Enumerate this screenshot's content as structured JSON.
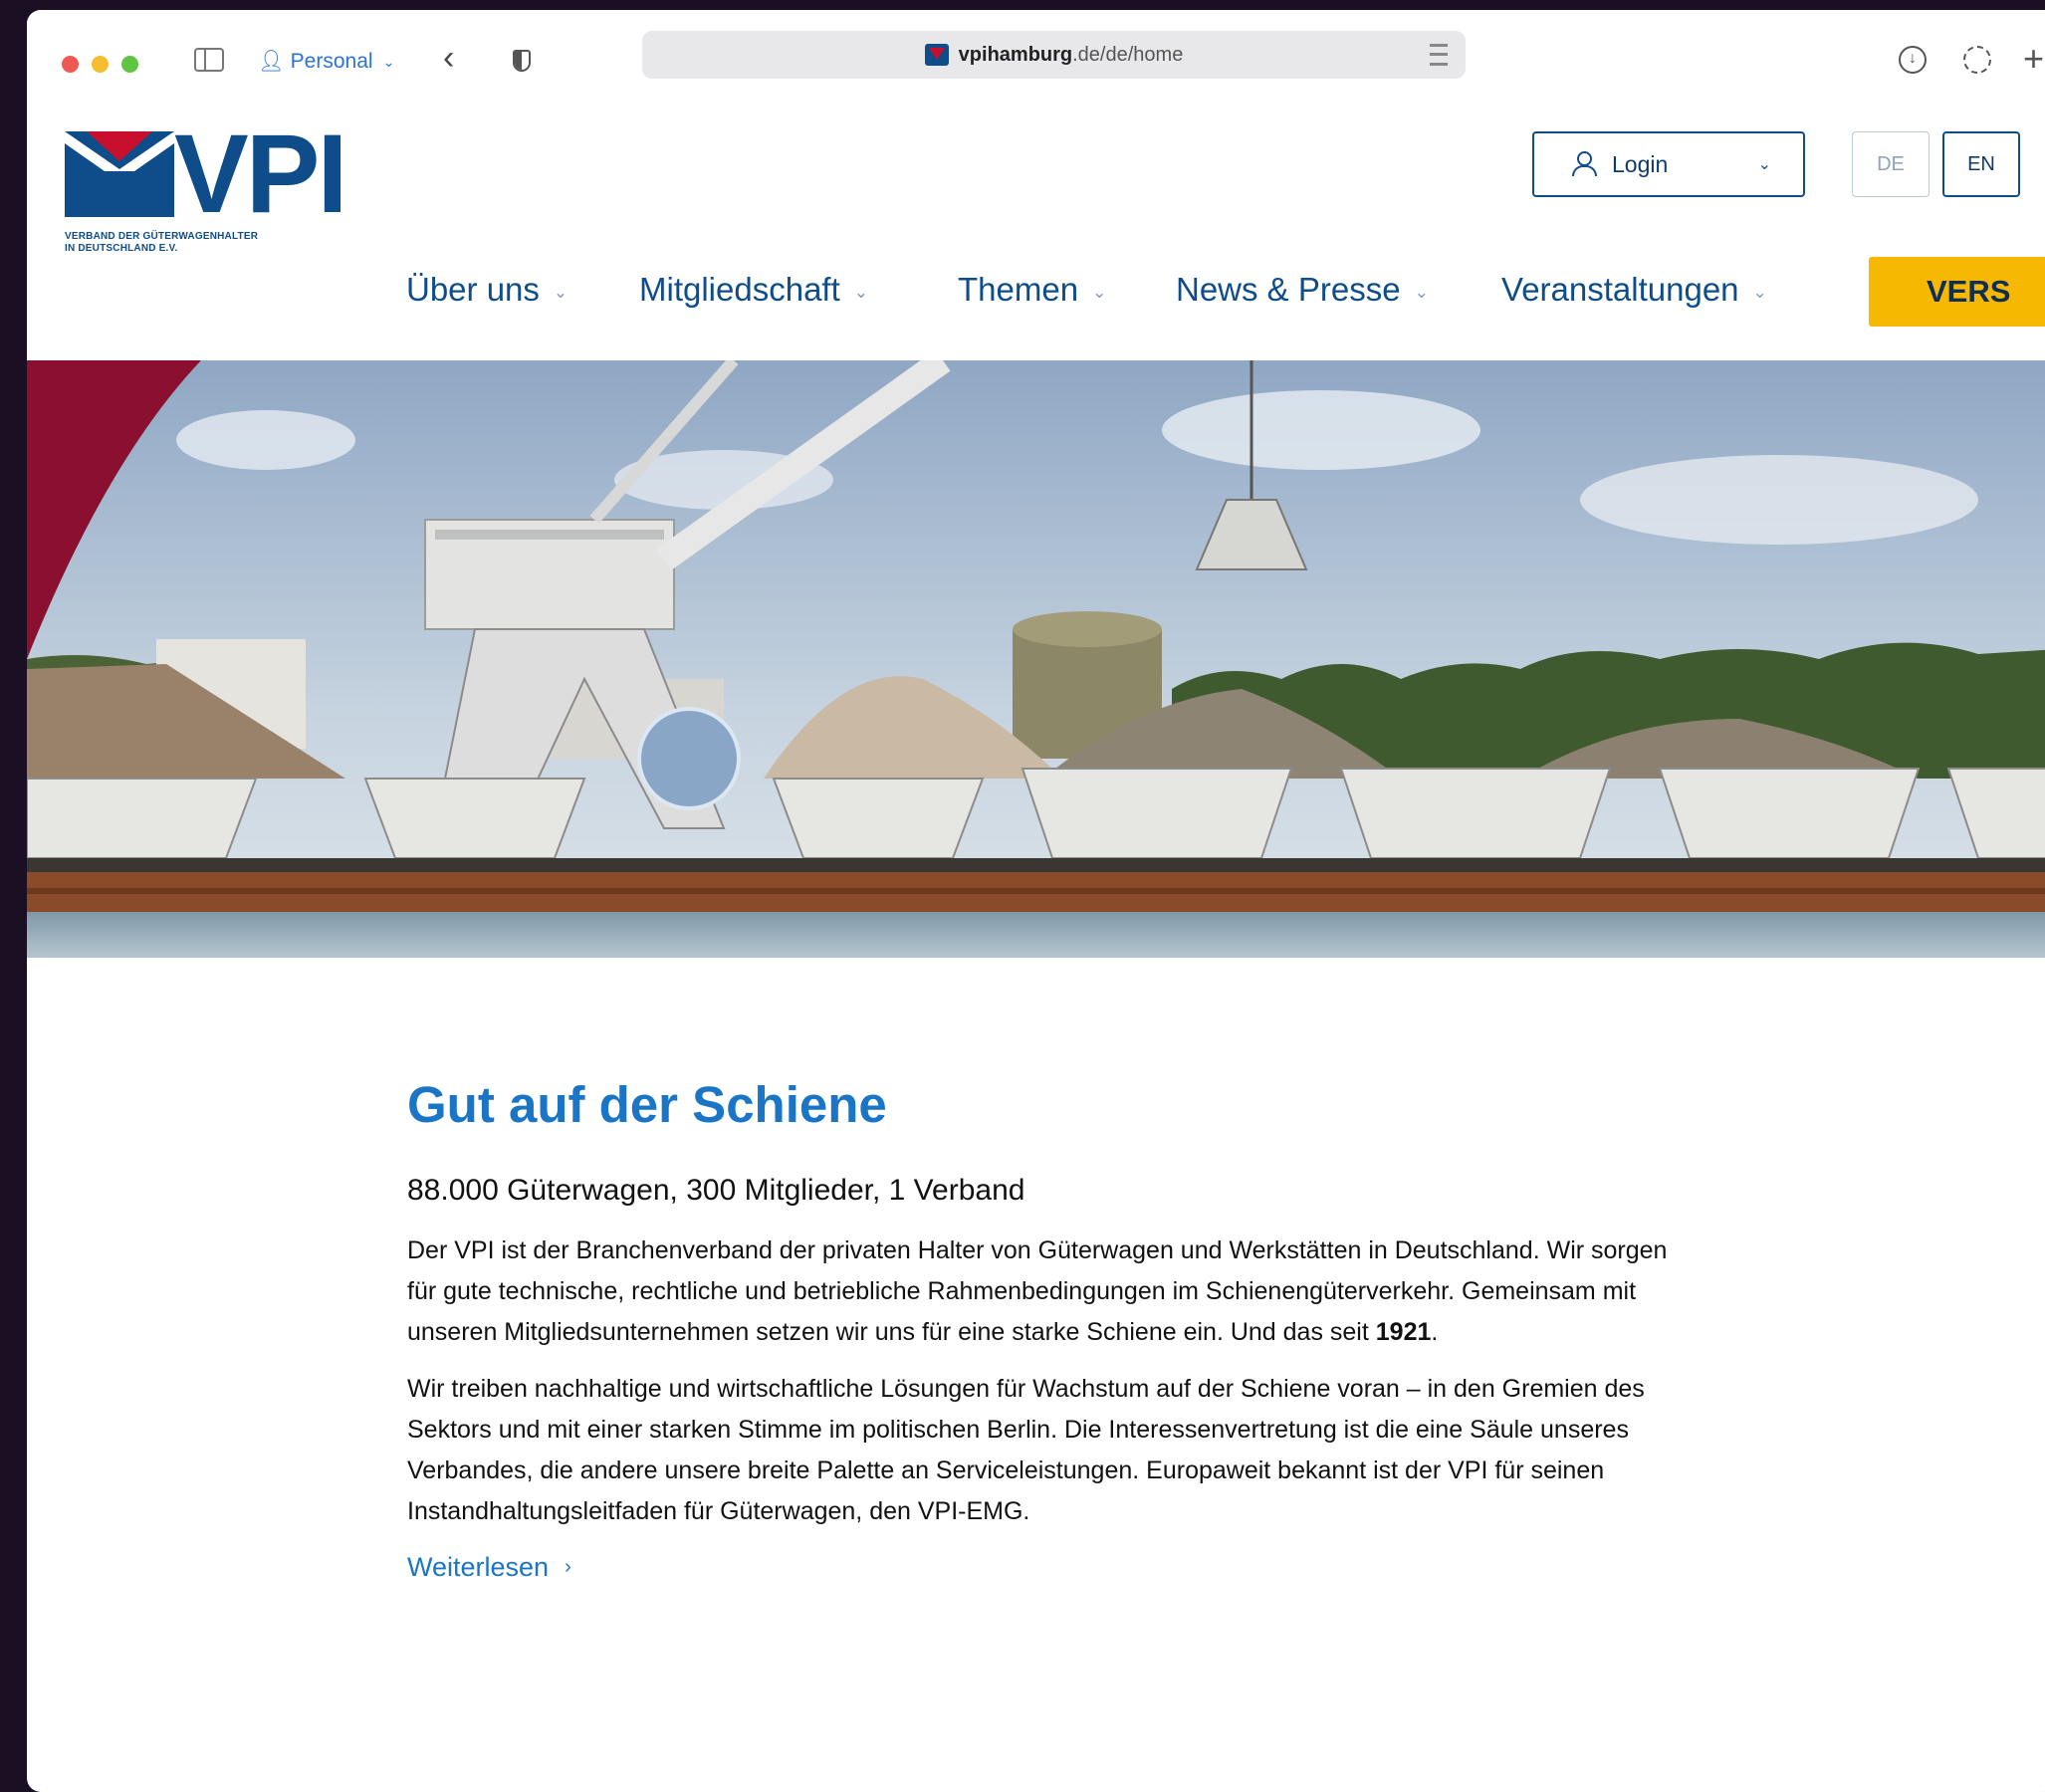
{
  "browser": {
    "profile": "Personal",
    "url_domain": "vpihamburg",
    "url_rest": ".de/de/home"
  },
  "header": {
    "logo_text": "VPI",
    "logo_subtitle_line1": "VERBAND DER GÜTERWAGENHALTER",
    "logo_subtitle_line2": "IN DEUTSCHLAND E.V.",
    "login_label": "Login",
    "lang_de": "DE",
    "lang_en": "EN",
    "nav": [
      {
        "label": "Über uns"
      },
      {
        "label": "Mitgliedschaft"
      },
      {
        "label": "Themen"
      },
      {
        "label": "News & Presse"
      },
      {
        "label": "Veranstaltungen"
      }
    ],
    "cta_label": "VERS"
  },
  "content": {
    "title": "Gut auf der Schiene",
    "subtitle": "88.000 Güterwagen, 300 Mitglieder, 1 Verband",
    "para1": "Der VPI ist der Branchenverband der privaten Halter von Güterwagen und Werkstätten in Deutschland. Wir sorgen für gute technische, rechtliche und betriebliche Rahmenbedingungen im Schienengüterverkehr. Gemeinsam mit unseren Mitgliedsunternehmen setzen wir uns für eine starke Schiene ein. Und das seit ",
    "para1_year": "1921",
    "para1_end": ".",
    "para2": "Wir treiben nachhaltige und wirtschaftliche Lösungen für Wachstum auf der Schiene voran – in den Gremien des Sektors und mit einer starken Stimme im politischen Berlin. Die Interessenvertretung ist die eine Säule unseres Verbandes, die andere unsere breite Palette an Serviceleistungen. Europaweit bekannt ist der VPI für seinen Instandhaltungsleitfaden für Güterwagen, den VPI-EMG.",
    "read_more": "Weiterlesen"
  },
  "colors": {
    "brand_blue": "#0f4d8a",
    "link_blue": "#1a75c6",
    "accent_yellow": "#f6b800",
    "accent_red": "#8b0f2e"
  }
}
